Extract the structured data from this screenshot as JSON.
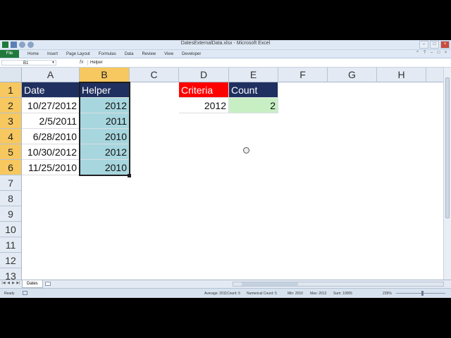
{
  "window": {
    "title": "DatesExternalData.xlsx - Microsoft Excel"
  },
  "ribbon": {
    "file_tab": "File",
    "tabs": [
      "Home",
      "Insert",
      "Page Layout",
      "Formulas",
      "Data",
      "Review",
      "View",
      "Developer"
    ]
  },
  "formula_bar": {
    "name_box": "B1",
    "fx": "fx",
    "content": "Helper"
  },
  "columns": [
    "A",
    "B",
    "C",
    "D",
    "E",
    "F",
    "G",
    "H"
  ],
  "rows": [
    "1",
    "2",
    "3",
    "4",
    "5",
    "6",
    "7",
    "8",
    "9",
    "10",
    "11",
    "12",
    "13"
  ],
  "cells": {
    "A1": "Date",
    "B1": "Helper",
    "A2": "10/27/2012",
    "B2": "2012",
    "A3": "2/5/2011",
    "B3": "2011",
    "A4": "6/28/2010",
    "B4": "2010",
    "A5": "10/30/2012",
    "B5": "2012",
    "A6": "11/25/2010",
    "B6": "2010",
    "D1": "Criteria",
    "E1": "Count",
    "D2": "2012",
    "E2": "2"
  },
  "sheet_tabs": [
    "Dates"
  ],
  "status_bar": {
    "ready": "Ready",
    "average": "Average: 2011",
    "count": "Count: 6",
    "numerical_count": "Numerical Count: 5",
    "min": "Min: 2010",
    "max": "Max: 2012",
    "sum": "Sum: 10055",
    "zoom": "239%"
  },
  "colors": {
    "header_navy": "#1f2f5f",
    "criteria_red": "#ff0000",
    "helper_teal": "#a7d6de",
    "count_green": "#c8efc4",
    "selected_header": "#f6c85f",
    "file_tab_green": "#1f7a3b"
  }
}
